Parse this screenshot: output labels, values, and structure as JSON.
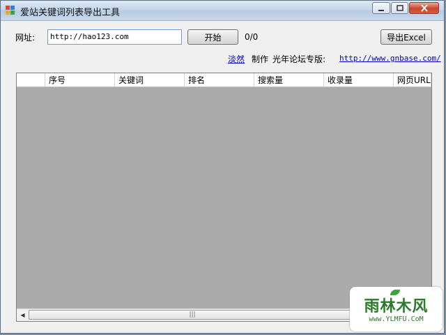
{
  "window": {
    "title": "爱站关键词列表导出工具"
  },
  "form": {
    "url_label": "网址:",
    "url_value": "http://hao123.com",
    "start_button": "开始",
    "progress": "0/0",
    "export_button": "导出Excel"
  },
  "credits": {
    "author_link": "淡然",
    "made_text": "制作",
    "edition_text": "光年论坛专版:",
    "site_link": "http://www.gnbase.com/"
  },
  "grid": {
    "columns": [
      "",
      "序号",
      "关键词",
      "排名",
      "搜索量",
      "收录量",
      "网页URL"
    ]
  },
  "watermark": {
    "main": "雨林木风",
    "sub": "www.YLMFU.CoM"
  },
  "colors": {
    "grid_background": "#ababab",
    "link": "#0000cc",
    "watermark": "#2b7a2b"
  }
}
